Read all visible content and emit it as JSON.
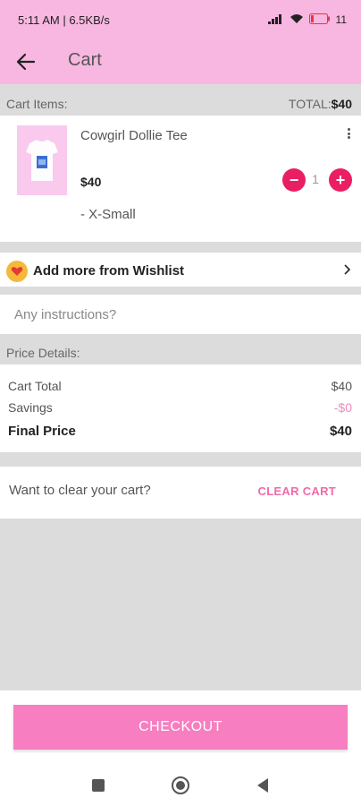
{
  "status_bar": {
    "time": "5:11 AM | 6.5KB/s",
    "battery": "11"
  },
  "app_bar": {
    "title": "Cart",
    "back_icon": "arrow-left-icon"
  },
  "cart_header": {
    "label": "Cart Items:",
    "total_label": "TOTAL:",
    "total_value": "$40"
  },
  "cart_item": {
    "name": "Cowgirl Dollie Tee",
    "price": "$40",
    "size": "- X-Small",
    "quantity": "1",
    "decrement_label": "−",
    "increment_label": "+"
  },
  "wishlist": {
    "label": "Add more from Wishlist",
    "icon": "heart-icon"
  },
  "instructions": {
    "placeholder": "Any instructions?"
  },
  "price_details": {
    "header": "Price Details:",
    "rows": [
      {
        "label": "Cart Total",
        "value": "$40"
      },
      {
        "label": "Savings",
        "value": "-$0"
      },
      {
        "label": "Final Price",
        "value": "$40"
      }
    ]
  },
  "clear": {
    "question": "Want to clear your cart?",
    "button": "CLEAR CART"
  },
  "checkout": {
    "label": "CHECKOUT"
  },
  "colors": {
    "header_pink": "#f8b7e0",
    "accent_red": "#e91e63",
    "checkout_pink": "#f77ec0",
    "clear_pink": "#f06ba8"
  }
}
